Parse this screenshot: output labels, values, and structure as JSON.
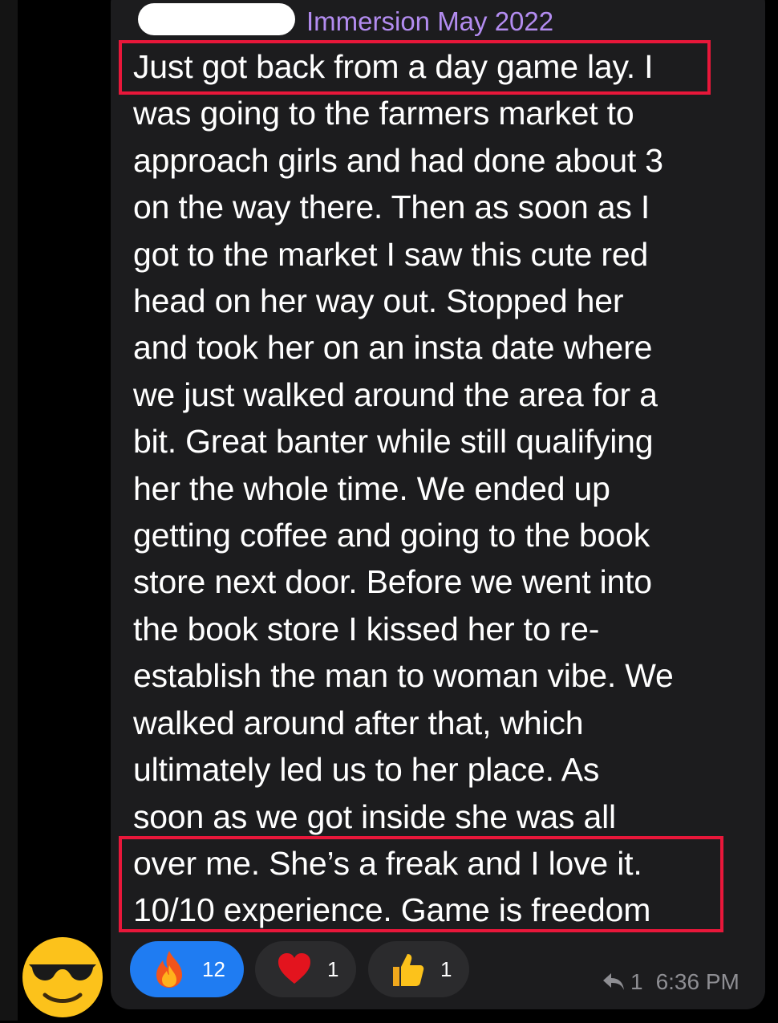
{
  "header": {
    "group_name": "Immersion May 2022"
  },
  "message": {
    "lines": [
      "Just got back from a day game lay. I",
      "was going to the farmers market to",
      "approach girls and had done about 3",
      "on the way there. Then as soon as I",
      "got to the market I saw this cute red",
      "head on her way out. Stopped her",
      "and took her on an insta date where",
      "we just walked around the area for a",
      "bit. Great banter while still qualifying",
      "her the whole time. We ended up",
      "getting coffee and going to the book",
      "store next door. Before we went into",
      "the book store I kissed her to re-",
      "establish the man to woman vibe. We",
      "walked around after that, which",
      "ultimately led us to her place. As",
      "soon as we got inside she was all",
      "over me. She’s a freak and I love it.",
      "10/10 experience. Game is freedom"
    ]
  },
  "reactions": [
    {
      "icon": "fire-icon",
      "count": "12",
      "active": true
    },
    {
      "icon": "heart-icon",
      "count": "1",
      "active": false
    },
    {
      "icon": "thumbs-up-icon",
      "count": "1",
      "active": false
    }
  ],
  "footer": {
    "reply_count": "1",
    "timestamp": "6:36 PM"
  },
  "colors": {
    "accent_name": "#b38cf0",
    "highlight": "#e8173a",
    "active_reaction": "#1f7cf2",
    "bubble": "#1c1c1e"
  }
}
